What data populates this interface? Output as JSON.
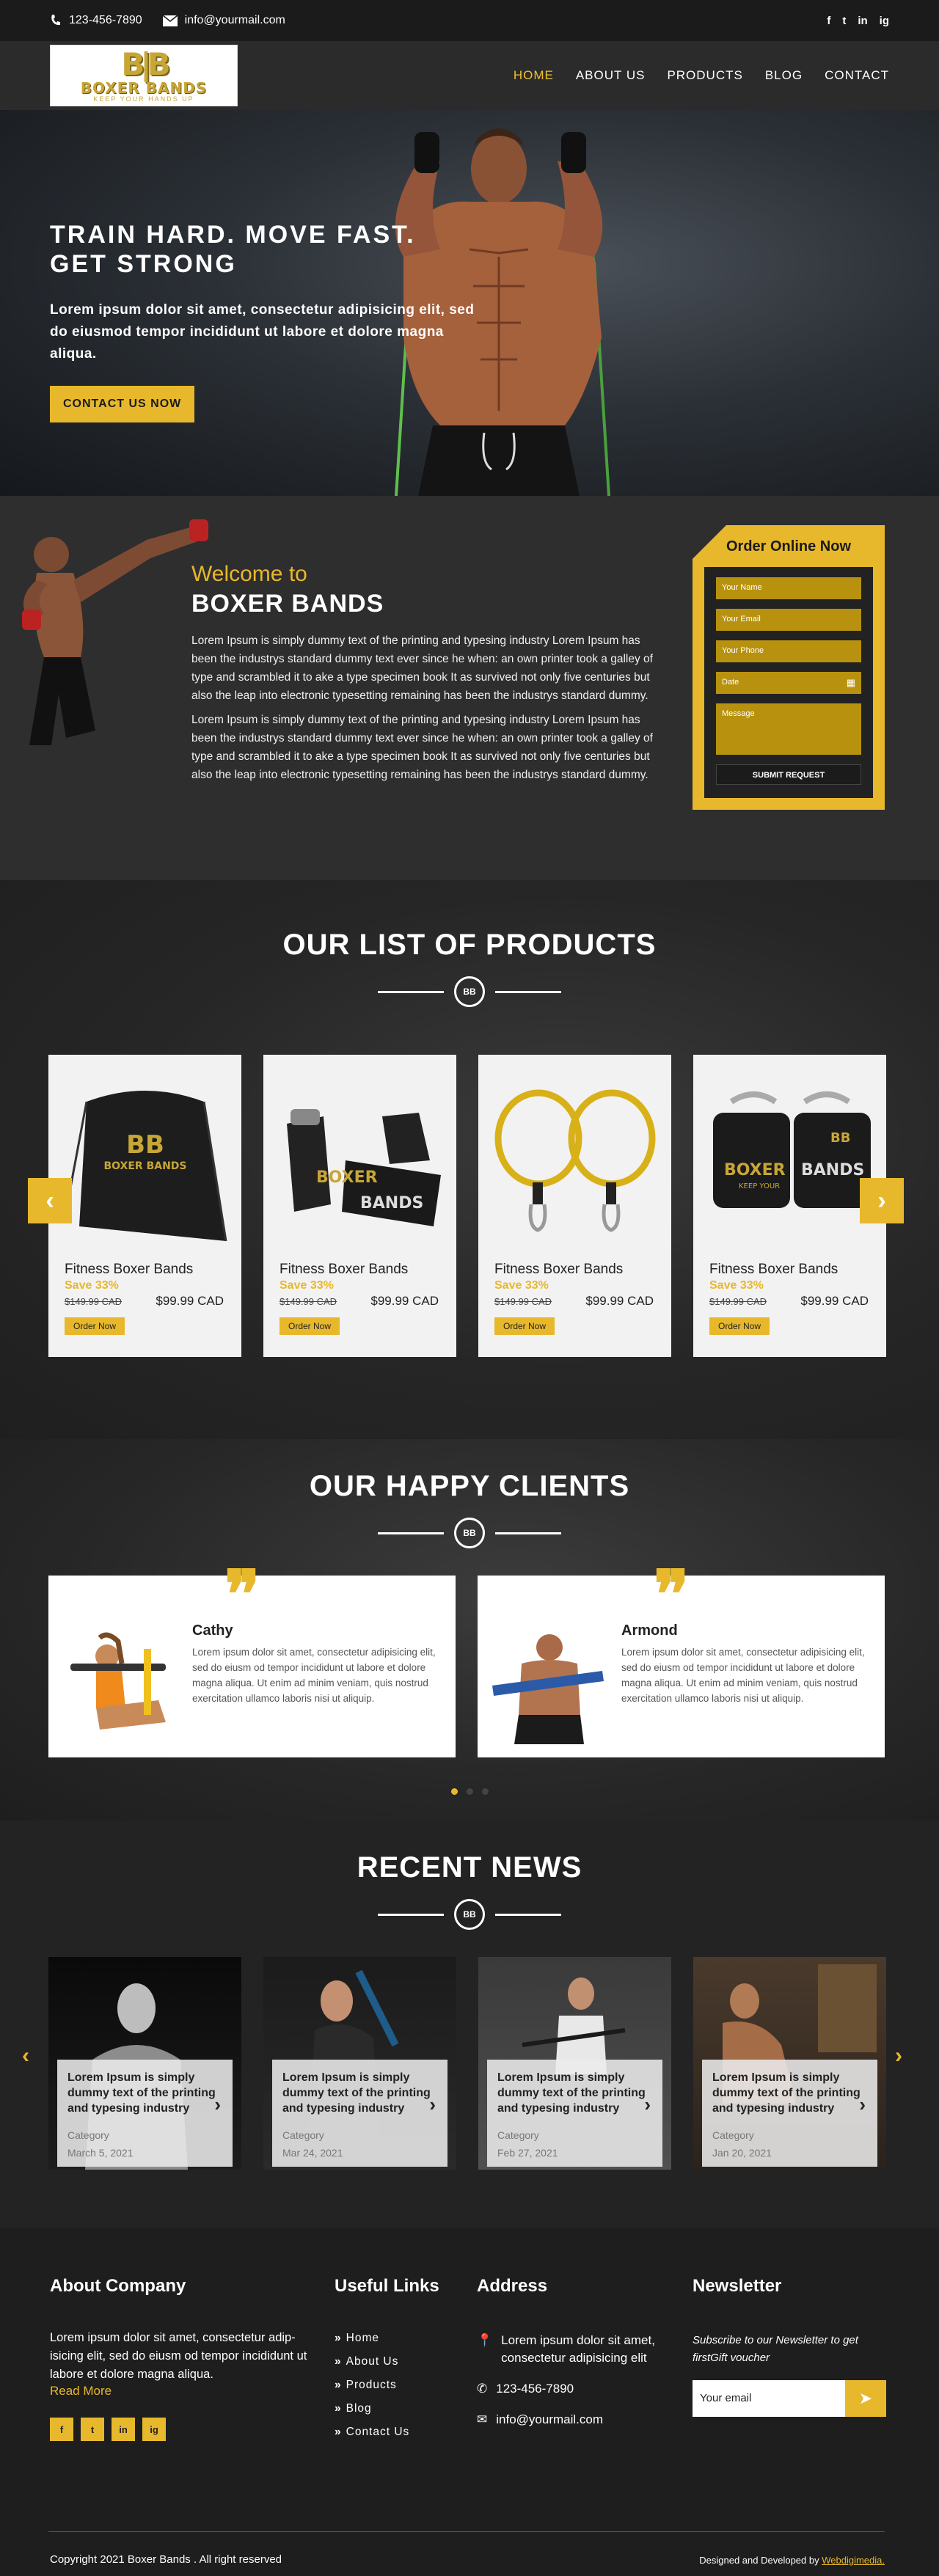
{
  "topbar": {
    "phone": "123-456-7890",
    "email": "info@yourmail.com",
    "social": [
      "f",
      "t",
      "in",
      "ig"
    ]
  },
  "nav": {
    "logo_mark": "B|B",
    "logo_name": "BOXER BANDS",
    "logo_tagline": "KEEP YOUR HANDS UP",
    "items": [
      "HOME",
      "ABOUT US",
      "PRODUCTS",
      "BLOG",
      "CONTACT"
    ],
    "active": "HOME"
  },
  "hero": {
    "headline_1": "TRAIN HARD. MOVE FAST.",
    "headline_2": "GET STRONG",
    "body": "Lorem ipsum dolor sit amet, consectetur adipisicing elit, sed do eiusmod tempor incididunt ut labore et dolore magna aliqua.",
    "cta": "CONTACT US NOW"
  },
  "welcome": {
    "subtitle": "Welcome to",
    "title": "BOXER BANDS",
    "para_1": "Lorem Ipsum is simply dummy text of the printing and typesing industry Lorem Ipsum has been the industrys standard dummy text ever since he when: an own printer took a galley of type and scrambled it to ake a type specimen book It as survived not only five centuries but also the leap into electronic typesetting remaining has been the industrys standard dummy.",
    "para_2": "Lorem Ipsum is simply dummy text of the printing and typesing industry Lorem Ipsum has been the industrys standard dummy text ever since he when: an own printer took a galley of type and scrambled it to ake a type specimen book It as survived not only five centuries but also the leap into electronic typesetting remaining has been the industrys standard dummy."
  },
  "order_form": {
    "title": "Order Online Now",
    "name_placeholder": "Your Name",
    "email_placeholder": "Your Email",
    "phone_placeholder": "Your Phone",
    "date_placeholder": "Date",
    "message_placeholder": "Message",
    "submit": "SUBMIT REQUEST"
  },
  "products": {
    "title": "OUR LIST OF PRODUCTS",
    "emblem": "BB",
    "items": [
      {
        "name": "Fitness Boxer Bands",
        "save": "Save 33%",
        "old_price": "$149.99 CAD",
        "price": "$99.99 CAD",
        "button": "Order Now"
      },
      {
        "name": "Fitness Boxer Bands",
        "save": "Save 33%",
        "old_price": "$149.99 CAD",
        "price": "$99.99 CAD",
        "button": "Order Now"
      },
      {
        "name": "Fitness Boxer Bands",
        "save": "Save 33%",
        "old_price": "$149.99 CAD",
        "price": "$99.99 CAD",
        "button": "Order Now"
      },
      {
        "name": "Fitness Boxer Bands",
        "save": "Save 33%",
        "old_price": "$149.99 CAD",
        "price": "$99.99 CAD",
        "button": "Order Now"
      }
    ],
    "bag_brand": "BOXER BANDS",
    "strap_text_1": "BOXER",
    "strap_text_2": "BANDS",
    "cuff_text_1": "BOXER",
    "cuff_text_2": "BANDS",
    "cuff_tagline": "KEEP YOUR"
  },
  "clients": {
    "title": "OUR HAPPY CLIENTS",
    "items": [
      {
        "name": "Cathy",
        "text": "Lorem ipsum dolor sit amet, consectetur adipisicing elit, sed do eiusm od tempor incididunt ut labore et dolore magna aliqua. Ut enim ad minim veniam, quis nostrud exercitation ullamco laboris nisi ut aliquip."
      },
      {
        "name": "Armond",
        "text": "Lorem ipsum dolor sit amet, consectetur adipisicing elit, sed do eiusm od tempor incididunt ut labore et dolore magna aliqua. Ut enim ad minim veniam, quis nostrud exercitation ullamco laboris nisi ut aliquip."
      }
    ],
    "active_slide": 0
  },
  "news": {
    "title": "RECENT NEWS",
    "items": [
      {
        "title": "Lorem Ipsum is simply dummy text of the printing and typesing industry",
        "category": "Category",
        "date": "March 5, 2021"
      },
      {
        "title": "Lorem Ipsum is simply dummy text of the printing and typesing industry",
        "category": "Category",
        "date": "Mar 24, 2021"
      },
      {
        "title": "Lorem Ipsum is simply dummy text of the printing and typesing industry",
        "category": "Category",
        "date": "Feb 27, 2021"
      },
      {
        "title": "Lorem Ipsum is simply dummy text of the printing and typesing industry",
        "category": "Category",
        "date": "Jan 20, 2021"
      }
    ]
  },
  "footer": {
    "about_title": "About Company",
    "about_text": "Lorem ipsum dolor sit amet, consectetur adip-isicing elit, sed do eiusm od tempor incididunt ut labore et dolore magna aliqua.",
    "read_more": "Read More",
    "social": [
      "f",
      "t",
      "in",
      "ig"
    ],
    "links_title": "Useful Links",
    "links": [
      "Home",
      "About Us",
      "Products",
      "Blog",
      "Contact Us"
    ],
    "address_title": "Address",
    "address": "Lorem ipsum dolor sit amet, consectetur adipisicing elit",
    "phone": "123-456-7890",
    "email": "info@yourmail.com",
    "newsletter_title": "Newsletter",
    "newsletter_text": "Subscribe to our Newsletter to get firstGift voucher",
    "newsletter_placeholder": "Your email",
    "copyright": "Copyright 2021 Boxer Bands . All right reserved",
    "credit": "Designed and Developed by",
    "credit_link": "Webdigimedia."
  },
  "colors": {
    "accent": "#e8b82c",
    "dark": "#222222",
    "card": "#f2f2f2"
  }
}
